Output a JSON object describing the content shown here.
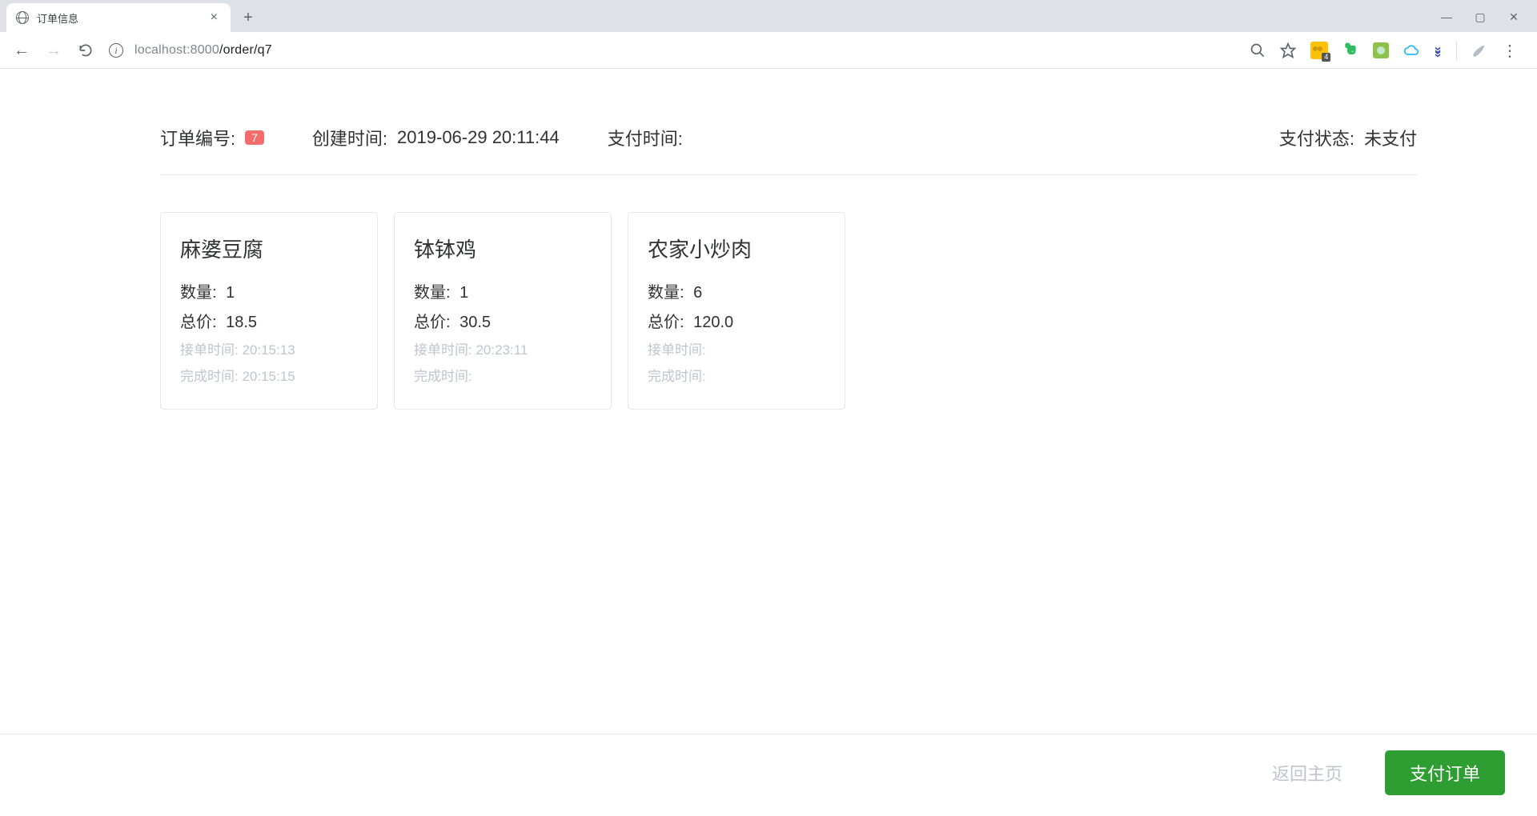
{
  "browser": {
    "tab_title": "订单信息",
    "url_host": "localhost",
    "url_port": ":8000",
    "url_path": "/order/q7",
    "ext_yellow_badge": "4"
  },
  "header": {
    "order_no_label": "订单编号:",
    "order_no": "7",
    "created_label": "创建时间:",
    "created_time": "2019-06-29 20:11:44",
    "paid_label": "支付时间:",
    "paid_time": "",
    "status_label": "支付状态:",
    "status_value": "未支付"
  },
  "row_labels": {
    "quantity": "数量:",
    "total": "总价:",
    "accept_time": "接单时间:",
    "complete_time": "完成时间:"
  },
  "cards": [
    {
      "name": "麻婆豆腐",
      "quantity": "1",
      "total": "18.5",
      "accept_time": "20:15:13",
      "complete_time": "20:15:15"
    },
    {
      "name": "钵钵鸡",
      "quantity": "1",
      "total": "30.5",
      "accept_time": "20:23:11",
      "complete_time": ""
    },
    {
      "name": "农家小炒肉",
      "quantity": "6",
      "total": "120.0",
      "accept_time": "",
      "complete_time": ""
    }
  ],
  "footer": {
    "back_label": "返回主页",
    "pay_label": "支付订单"
  }
}
